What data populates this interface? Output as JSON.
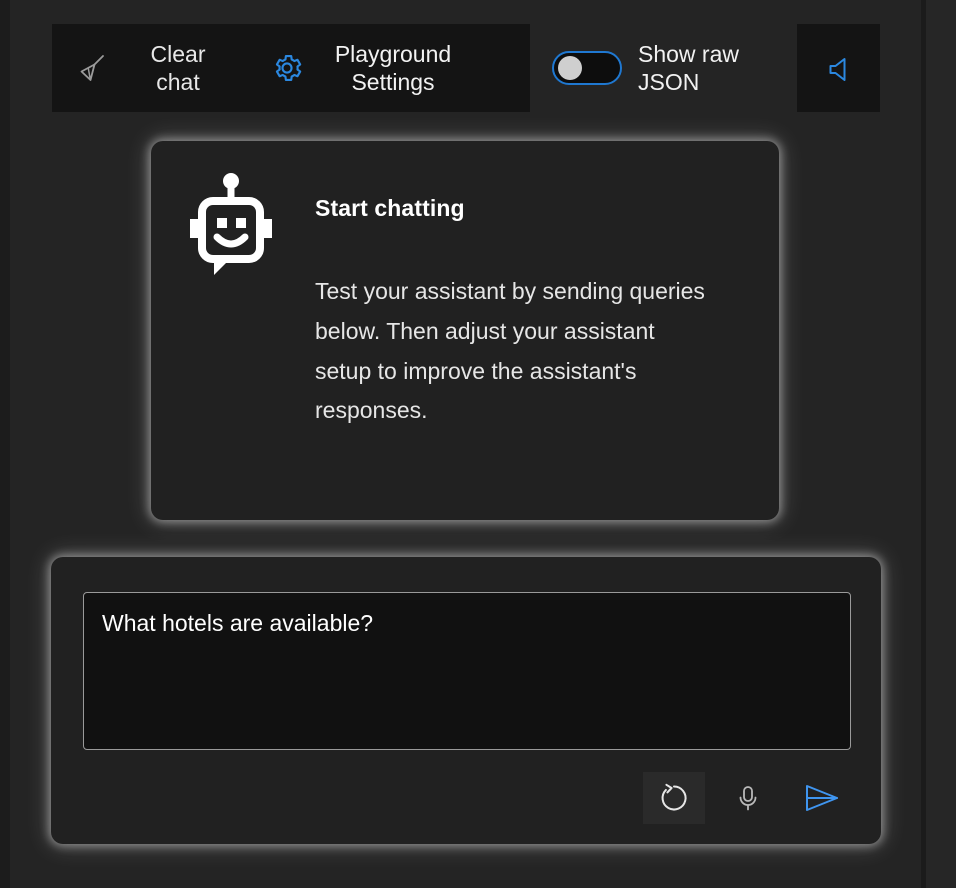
{
  "toolbar": {
    "clear_chat": {
      "label": "Clear chat",
      "icon": "broom-icon"
    },
    "playground_settings": {
      "label": "Playground Settings",
      "icon": "gear-icon"
    },
    "show_raw_json": {
      "label": "Show raw JSON",
      "state": "off",
      "icon": "toggle-switch"
    },
    "sound": {
      "icon": "speaker-icon",
      "label": ""
    }
  },
  "chat_card": {
    "icon": "bot-icon",
    "title": "Start chatting",
    "body": "Test your assistant by sending queries below. Then adjust your assistant setup to improve the assistant's responses."
  },
  "compose": {
    "input_value": "What hotels are available?",
    "input_placeholder": "",
    "actions": {
      "regenerate": {
        "icon": "refresh-icon",
        "label": ""
      },
      "microphone": {
        "icon": "microphone-icon",
        "label": ""
      },
      "send": {
        "icon": "send-icon",
        "label": ""
      }
    }
  },
  "colors": {
    "background": "#242424",
    "panel": "#141414",
    "card": "#212121",
    "accent_blue": "#2b88e0",
    "text_primary": "#ffffff",
    "text_secondary": "#e6e6e6",
    "input_background": "#111111",
    "input_border": "#9a9a9a"
  }
}
